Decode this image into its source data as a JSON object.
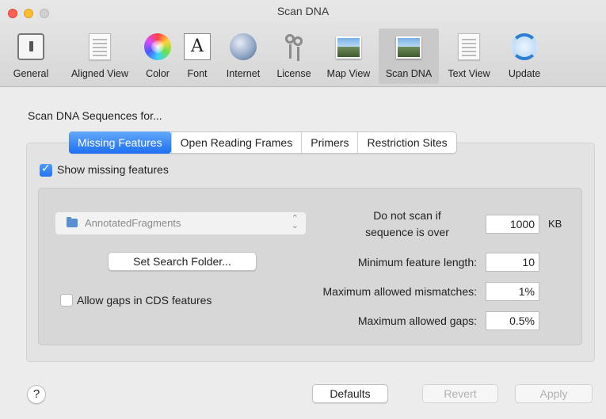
{
  "window": {
    "title": "Scan DNA"
  },
  "toolbar": {
    "items": [
      {
        "label": "General",
        "icon": "switch-icon"
      },
      {
        "label": "Aligned View",
        "icon": "document-icon"
      },
      {
        "label": "Color",
        "icon": "color-wheel-icon"
      },
      {
        "label": "Font",
        "icon": "font-icon"
      },
      {
        "label": "Internet",
        "icon": "globe-icon"
      },
      {
        "label": "License",
        "icon": "keys-icon"
      },
      {
        "label": "Map View",
        "icon": "photo-icon"
      },
      {
        "label": "Scan DNA",
        "icon": "photo-icon",
        "selected": true
      },
      {
        "label": "Text View",
        "icon": "document-icon"
      },
      {
        "label": "Update",
        "icon": "update-icon"
      }
    ]
  },
  "section_heading": "Scan DNA Sequences for...",
  "tabs": [
    {
      "label": "Missing Features",
      "active": true
    },
    {
      "label": "Open Reading Frames"
    },
    {
      "label": "Primers"
    },
    {
      "label": "Restriction Sites"
    }
  ],
  "show_missing": {
    "label": "Show missing features",
    "checked": true
  },
  "folder_popup": {
    "value": "AnnotatedFragments",
    "icon": "folder-icon"
  },
  "set_folder_button": "Set Search Folder...",
  "allow_gaps": {
    "label": "Allow gaps in CDS features",
    "checked": false
  },
  "settings": {
    "max_size_label_1": "Do not scan if",
    "max_size_label_2": "sequence is over",
    "max_size_value": "1000",
    "max_size_unit": "KB",
    "min_length_label": "Minimum feature length:",
    "min_length_value": "10",
    "mismatch_label": "Maximum allowed mismatches:",
    "mismatch_value": "1%",
    "gaps_label": "Maximum allowed gaps:",
    "gaps_value": "0.5%"
  },
  "footer": {
    "help": "?",
    "defaults": "Defaults",
    "revert": "Revert",
    "apply": "Apply"
  },
  "colors": {
    "accent": "#1e6ff2",
    "window_bg": "#ececec"
  }
}
